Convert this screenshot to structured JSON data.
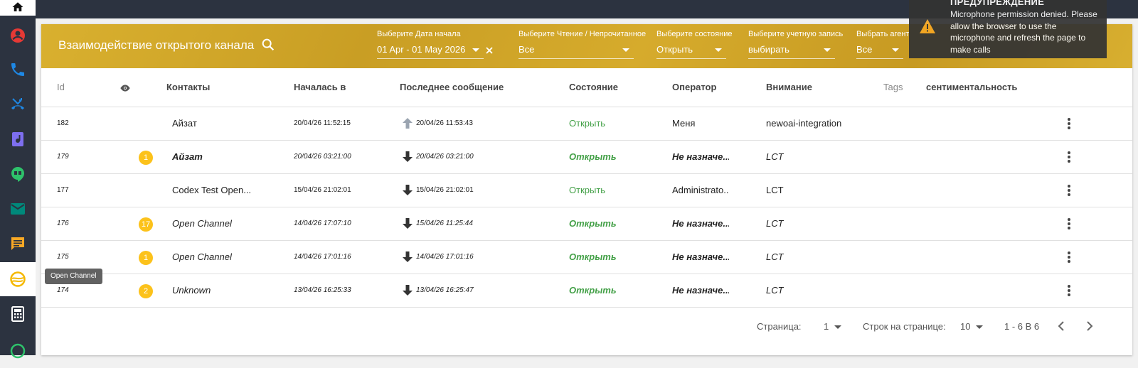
{
  "header": {
    "title": "Взаимодействие открытого канала",
    "filters": {
      "date": {
        "label": "Выберите Дата начала",
        "value": "01 Apr - 01 May 2026"
      },
      "read": {
        "label": "Выберите Чтение / Непрочитанное",
        "value": "Все"
      },
      "state": {
        "label": "Выберите состояние",
        "value": "Открыть"
      },
      "account": {
        "label": "Выберите учетную запись",
        "value": "выбирать"
      },
      "agent": {
        "label": "Выбрать агент",
        "value": "Все"
      }
    }
  },
  "table": {
    "columns": {
      "id": "Id",
      "contacts": "Контакты",
      "started": "Началась в",
      "last_message": "Последнее сообщение",
      "state": "Состояние",
      "operator": "Оператор",
      "attention": "Внимание",
      "tags": "Tags",
      "sentiment": "сентиментальность"
    },
    "rows": [
      {
        "id": "182",
        "badge": "",
        "contact": "Айзат",
        "started": "20/04/26 11:52:15",
        "direction": "outgoing",
        "last": "20/04/26 11:53:43",
        "state": "Открыть",
        "operator": "Меня",
        "attention": "newoai-integration",
        "unread": false
      },
      {
        "id": "179",
        "badge": "1",
        "contact": "Айзат",
        "started": "20/04/26 03:21:00",
        "direction": "incoming",
        "last": "20/04/26 03:21:00",
        "state": "Открыть",
        "operator": "Не назначе...",
        "attention": "LCT",
        "unread": true
      },
      {
        "id": "177",
        "badge": "",
        "contact": "Codex Test Open...",
        "started": "15/04/26 21:02:01",
        "direction": "incoming",
        "last": "15/04/26 21:02:01",
        "state": "Открыть",
        "operator": "Administrato...",
        "attention": "LCT",
        "unread": false
      },
      {
        "id": "176",
        "badge": "17",
        "contact": "Open Channel",
        "started": "14/04/26 17:07:10",
        "direction": "incoming",
        "last": "15/04/26 11:25:44",
        "state": "Открыть",
        "operator": "Не назначе...",
        "attention": "LCT",
        "unread": true
      },
      {
        "id": "175",
        "badge": "1",
        "contact": "Open Channel",
        "started": "14/04/26 17:01:16",
        "direction": "incoming",
        "last": "14/04/26 17:01:16",
        "state": "Открыть",
        "operator": "Не назначе...",
        "attention": "LCT",
        "unread": true
      },
      {
        "id": "174",
        "badge": "2",
        "contact": "Unknown",
        "started": "13/04/26 16:25:33",
        "direction": "incoming",
        "last": "13/04/26 16:25:47",
        "state": "Открыть",
        "operator": "Не назначе...",
        "attention": "LCT",
        "unread": true
      }
    ]
  },
  "footer": {
    "page_label": "Страница:",
    "page_value": "1",
    "rows_label": "Строк на странице:",
    "rows_value": "10",
    "range": "1 - 6 В 6"
  },
  "toast": {
    "title": "ПРЕДУПРЕЖДЕНИЕ",
    "message": "Microphone permission denied. Please allow the browser to use the microphone and refresh the page to make calls"
  },
  "tooltip": "Open Channel",
  "sidebar": {
    "items": [
      {
        "icon": "home-icon",
        "color": "#000000"
      },
      {
        "icon": "account-icon",
        "color": "#e53935"
      },
      {
        "icon": "phone-icon",
        "color": "#1e88e5"
      },
      {
        "icon": "call-missed-icon",
        "color": "#1e88e5"
      },
      {
        "icon": "voicemail-icon",
        "color": "#7e6ff0"
      },
      {
        "icon": "hangouts-icon",
        "color": "#2ec26b"
      },
      {
        "icon": "email-icon",
        "color": "#00897b"
      },
      {
        "icon": "chat-icon",
        "color": "#f9a825"
      },
      {
        "icon": "open-channel-icon",
        "color": "#f5b800"
      },
      {
        "icon": "calculator-icon",
        "color": "#ffffff"
      },
      {
        "icon": "whatsapp-icon",
        "color": "#2ec26b"
      }
    ]
  },
  "colors": {
    "header_gold": "#d4a92b",
    "sidebar_bg": "#2c3340",
    "badge": "#fcc21b",
    "state_green": "#43a047"
  }
}
